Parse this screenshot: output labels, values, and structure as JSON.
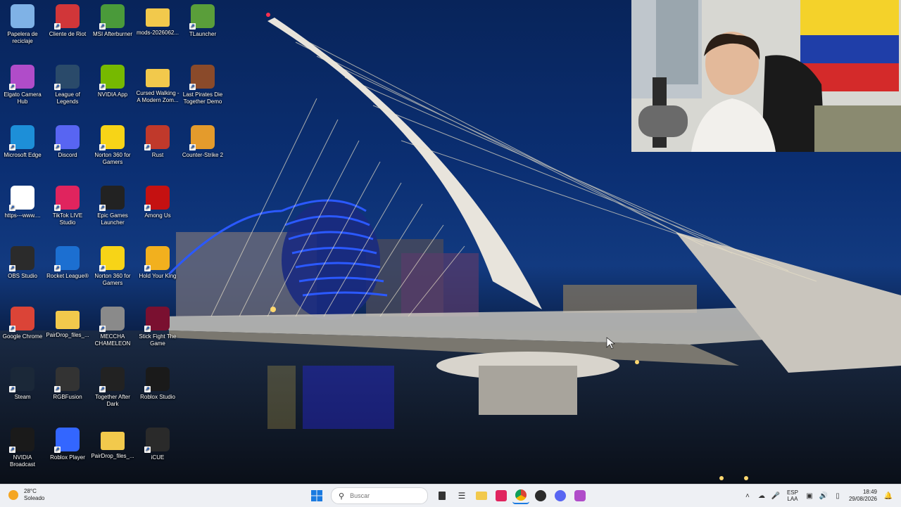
{
  "desktop_icons": [
    {
      "label": "Papelera de reciclaje",
      "icon": "recycle-bin-icon",
      "color": "#7fb2e6"
    },
    {
      "label": "Cliente de Riot",
      "icon": "riot-client-icon",
      "color": "#d13639"
    },
    {
      "label": "MSI Afterburner",
      "icon": "msi-afterburner-icon",
      "color": "#4a9a3a"
    },
    {
      "label": "mods-2026062...",
      "icon": "folder-icon",
      "color": "#f2c94c"
    },
    {
      "label": "TLauncher",
      "icon": "tlauncher-icon",
      "color": "#5a9e3a"
    },
    {
      "label": "Elgato Camera Hub",
      "icon": "elgato-camera-hub-icon",
      "color": "#b04cc9"
    },
    {
      "label": "League of Legends",
      "icon": "league-of-legends-icon",
      "color": "#2a4a6a"
    },
    {
      "label": "NVIDIA App",
      "icon": "nvidia-app-icon",
      "color": "#76b900"
    },
    {
      "label": "Cursed Walking - A Modern Zom...",
      "icon": "folder-icon",
      "color": "#f2c94c"
    },
    {
      "label": "Last Pirates Die Together Demo",
      "icon": "last-pirates-icon",
      "color": "#8a4a2a"
    },
    {
      "label": "Microsoft Edge",
      "icon": "edge-icon",
      "color": "#1d8fd8"
    },
    {
      "label": "Discord",
      "icon": "discord-icon",
      "color": "#5865f2"
    },
    {
      "label": "Norton 360 for Gamers",
      "icon": "norton-icon",
      "color": "#f7d417"
    },
    {
      "label": "Rust",
      "icon": "rust-icon",
      "color": "#c0392b"
    },
    {
      "label": "Counter-Strike 2",
      "icon": "counter-strike-icon",
      "color": "#e49b2c"
    },
    {
      "label": "https---www....",
      "icon": "chrome-link-icon",
      "color": "#ffffff"
    },
    {
      "label": "TikTok LIVE Studio",
      "icon": "tiktok-live-icon",
      "color": "#e0245e"
    },
    {
      "label": "Epic Games Launcher",
      "icon": "epic-games-icon",
      "color": "#222222"
    },
    {
      "label": "Among Us",
      "icon": "among-us-icon",
      "color": "#c51111"
    },
    {
      "label": "OBS Studio",
      "icon": "obs-icon",
      "color": "#2b2b2b"
    },
    {
      "label": "Rocket League®",
      "icon": "rocket-league-icon",
      "color": "#1c6fd1"
    },
    {
      "label": "Norton 360 for Gamers",
      "icon": "norton-icon",
      "color": "#f7d417"
    },
    {
      "label": "Hold Your King",
      "icon": "hold-your-king-icon",
      "color": "#f2b01e"
    },
    {
      "label": "Google Chrome",
      "icon": "chrome-icon",
      "color": "#db4437"
    },
    {
      "label": "PairDrop_files_...",
      "icon": "folder-icon",
      "color": "#f2c94c"
    },
    {
      "label": "MECCHA CHAMELEON",
      "icon": "meccha-chameleon-icon",
      "color": "#8a8a8a"
    },
    {
      "label": "Stick Fight The Game",
      "icon": "stick-fight-icon",
      "color": "#7a1030"
    },
    {
      "label": "Steam",
      "icon": "steam-icon",
      "color": "#1b2838"
    },
    {
      "label": "RGBFusion",
      "icon": "rgb-fusion-icon",
      "color": "#333333"
    },
    {
      "label": "Together After Dark",
      "icon": "epic-games-icon",
      "color": "#222222"
    },
    {
      "label": "Roblox Studio",
      "icon": "roblox-studio-icon",
      "color": "#1a1a1a"
    },
    {
      "label": "NVIDIA Broadcast",
      "icon": "nvidia-broadcast-icon",
      "color": "#1a1a1a"
    },
    {
      "label": "Roblox Player",
      "icon": "roblox-player-icon",
      "color": "#3366ff"
    },
    {
      "label": "PairDrop_files_...",
      "icon": "folder-icon",
      "color": "#f2c94c"
    },
    {
      "label": "iCUE",
      "icon": "icue-icon",
      "color": "#2a2a2a"
    }
  ],
  "taskbar": {
    "weather_temp": "28°C",
    "weather_desc": "Soleado",
    "search_placeholder": "Buscar",
    "pinned": [
      "task-view-icon",
      "widgets-icon",
      "file-explorer-icon",
      "tiktok-live-icon",
      "chrome-icon",
      "riot-client-icon",
      "discord-icon",
      "elgato-icon"
    ],
    "lang_top": "ESP",
    "lang_bottom": "LAA",
    "time": "18:49",
    "date": "29/08/2026"
  }
}
